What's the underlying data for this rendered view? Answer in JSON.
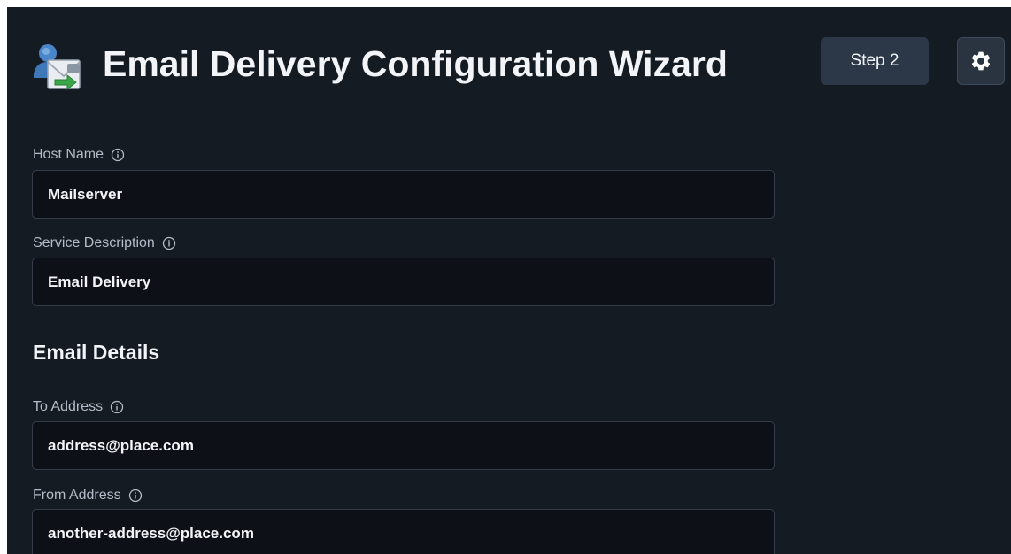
{
  "header": {
    "app_icon": "mail-transfer-icon",
    "title": "Email Delivery Configuration Wizard",
    "step_label": "Step 2",
    "settings_icon": "gear-icon"
  },
  "form": {
    "host_name": {
      "label": "Host Name",
      "value": "Mailserver",
      "info_icon": "info-icon"
    },
    "service_description": {
      "label": "Service Description",
      "value": "Email Delivery",
      "info_icon": "info-icon"
    },
    "email_details": {
      "heading": "Email Details",
      "to_address": {
        "label": "To Address",
        "value": "address@place.com",
        "info_icon": "info-icon"
      },
      "from_address": {
        "label": "From Address",
        "value": "another-address@place.com",
        "info_icon": "info-icon"
      }
    }
  },
  "colors": {
    "panel_background": "#151b23",
    "input_background": "#0d1117",
    "input_border": "#343d49",
    "button_background": "#2c3848",
    "text_primary": "#f2f4f7",
    "text_label": "#b3bcc8"
  }
}
